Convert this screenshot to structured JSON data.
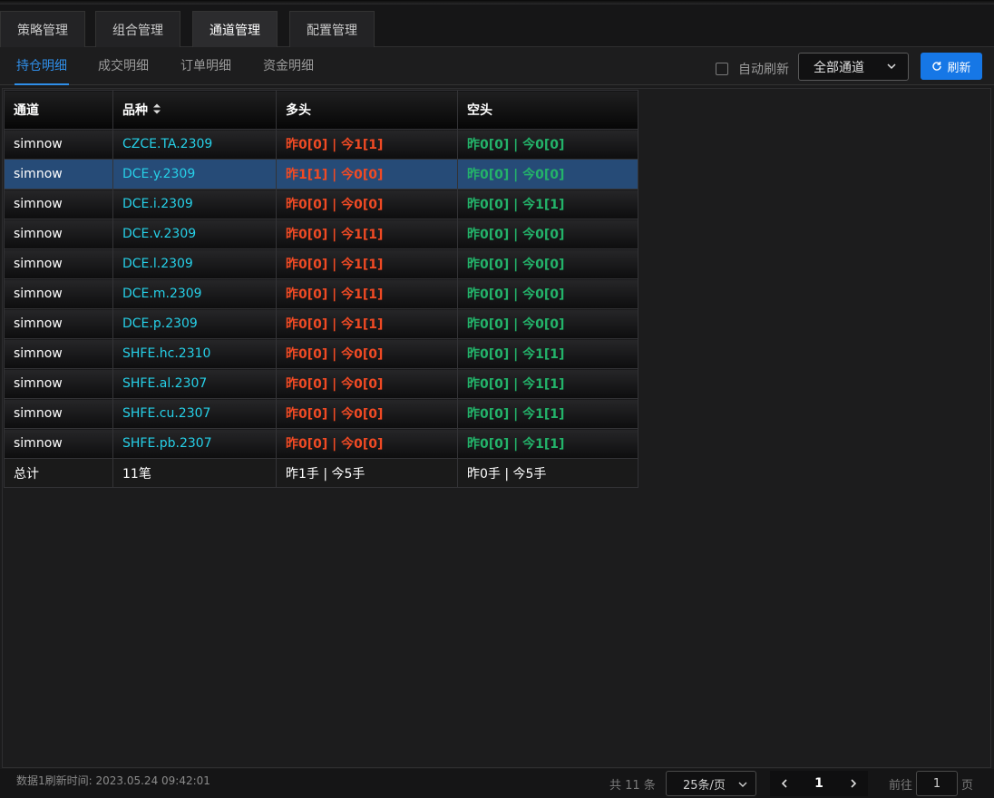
{
  "main_tabs": [
    {
      "label": "策略管理"
    },
    {
      "label": "组合管理"
    },
    {
      "label": "通道管理"
    },
    {
      "label": "配置管理"
    }
  ],
  "sub_tabs": [
    {
      "label": "持仓明细"
    },
    {
      "label": "成交明细"
    },
    {
      "label": "订单明细"
    },
    {
      "label": "资金明细"
    }
  ],
  "toolbar": {
    "auto_refresh_label": "自动刷新",
    "channel_select_value": "全部通道",
    "refresh_label": "刷新"
  },
  "table": {
    "headers": {
      "channel": "通道",
      "symbol": "品种",
      "long": "多头",
      "short": "空头"
    },
    "rows": [
      {
        "channel": "simnow",
        "symbol": "CZCE.TA.2309",
        "long": "昨0[0] | 今1[1]",
        "short": "昨0[0] | 今0[0]"
      },
      {
        "channel": "simnow",
        "symbol": "DCE.y.2309",
        "long": "昨1[1] | 今0[0]",
        "short": "昨0[0] | 今0[0]"
      },
      {
        "channel": "simnow",
        "symbol": "DCE.i.2309",
        "long": "昨0[0] | 今0[0]",
        "short": "昨0[0] | 今1[1]"
      },
      {
        "channel": "simnow",
        "symbol": "DCE.v.2309",
        "long": "昨0[0] | 今1[1]",
        "short": "昨0[0] | 今0[0]"
      },
      {
        "channel": "simnow",
        "symbol": "DCE.l.2309",
        "long": "昨0[0] | 今1[1]",
        "short": "昨0[0] | 今0[0]"
      },
      {
        "channel": "simnow",
        "symbol": "DCE.m.2309",
        "long": "昨0[0] | 今1[1]",
        "short": "昨0[0] | 今0[0]"
      },
      {
        "channel": "simnow",
        "symbol": "DCE.p.2309",
        "long": "昨0[0] | 今1[1]",
        "short": "昨0[0] | 今0[0]"
      },
      {
        "channel": "simnow",
        "symbol": "SHFE.hc.2310",
        "long": "昨0[0] | 今0[0]",
        "short": "昨0[0] | 今1[1]"
      },
      {
        "channel": "simnow",
        "symbol": "SHFE.al.2307",
        "long": "昨0[0] | 今0[0]",
        "short": "昨0[0] | 今1[1]"
      },
      {
        "channel": "simnow",
        "symbol": "SHFE.cu.2307",
        "long": "昨0[0] | 今0[0]",
        "short": "昨0[0] | 今1[1]"
      },
      {
        "channel": "simnow",
        "symbol": "SHFE.pb.2307",
        "long": "昨0[0] | 今0[0]",
        "short": "昨0[0] | 今1[1]"
      }
    ],
    "total": {
      "label": "总计",
      "count": "11笔",
      "long": "昨1手 | 今5手",
      "short": "昨0手 | 今5手"
    }
  },
  "footer": {
    "refresh_time": "数据1刷新时间: 2023.05.24 09:42:01",
    "total_count": "共 11 条",
    "page_size": "25条/页",
    "current_page": "1",
    "goto_label": "前往",
    "goto_value": "1",
    "goto_suffix": "页"
  },
  "colors": {
    "accent": "#2f8ee8",
    "button": "#1677e6",
    "long": "#f04a24",
    "short": "#23b36a",
    "symbol": "#26d0e8",
    "selected_row": "#264b77"
  },
  "icons": {
    "refresh": "refresh-icon",
    "sort": "sort-icon",
    "chevron_down": "chevron-down-icon",
    "prev": "chevron-left-icon",
    "next": "chevron-right-icon"
  }
}
